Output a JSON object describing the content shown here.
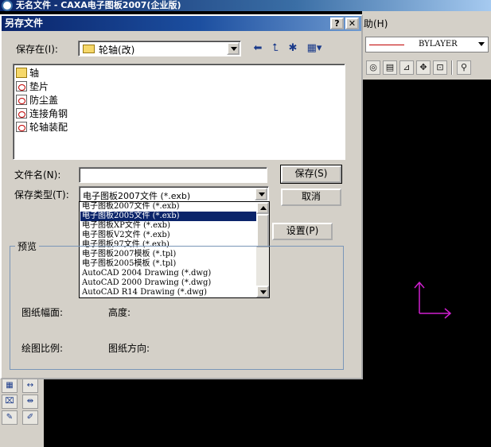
{
  "app": {
    "title": "无名文件 - CAXA电子图板2007(企业版)",
    "menu_help": "助(H)",
    "layer_value": "BYLAYER",
    "toolbar_icons": [
      "circle-icon",
      "sheet-icon",
      "measure-icon",
      "snap-icon",
      "zoom-window-icon",
      "zoom-icon"
    ]
  },
  "dialog": {
    "title": "另存文件",
    "help_label": "?",
    "close_label": "✕",
    "savein_label": "保存在(I):",
    "savein_value": "轮轴(改)",
    "files": [
      {
        "name": "轴",
        "type": "folder"
      },
      {
        "name": "垫片",
        "type": "exb"
      },
      {
        "name": "防尘盖",
        "type": "exb"
      },
      {
        "name": "连接角钢",
        "type": "exb"
      },
      {
        "name": "轮轴装配",
        "type": "exb"
      }
    ],
    "filename_label": "文件名(N):",
    "filename_value": "",
    "filetype_label": "保存类型(T):",
    "filetype_value": "电子图板2007文件 (*.exb)",
    "filetype_options": [
      "电子图板2007文件 (*.exb)",
      "电子图板2005文件 (*.exb)",
      "电子图板XP文件 (*.exb)",
      "电子图板V2文件 (*.exb)",
      "电子图板97文件 (*.exb)",
      "电子图板2007模板 (*.tpl)",
      "电子图板2005模板 (*.tpl)",
      "AutoCAD 2004 Drawing (*.dwg)",
      "AutoCAD 2000 Drawing (*.dwg)",
      "AutoCAD R14 Drawing (*.dwg)"
    ],
    "selected_option_index": 1,
    "save_label": "保存(S)",
    "cancel_label": "取消",
    "settings_label": "设置(P)",
    "preview": {
      "legend": "预览",
      "sheet_size_label": "图纸幅面:",
      "height_label": "高度:",
      "scale_label": "绘图比例:",
      "orientation_label": "图纸方向:"
    }
  },
  "colors": {
    "title_gradient_start": "#0a246a",
    "selection": "#0a246a",
    "canvas": "#000000",
    "ucs": "#d020d0",
    "dialog_face": "#d4d0c8"
  }
}
